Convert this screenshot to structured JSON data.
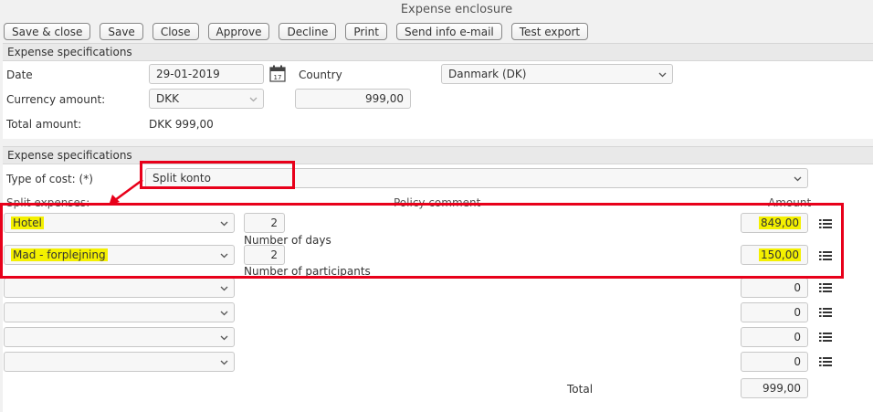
{
  "window_title": "Expense enclosure",
  "toolbar": {
    "buttons": [
      "Save & close",
      "Save",
      "Close",
      "Approve",
      "Decline",
      "Print",
      "Send info e-mail",
      "Test export"
    ]
  },
  "section1": {
    "title": "Expense specifications",
    "date_label": "Date",
    "date_value": "29-01-2019",
    "country_label": "Country",
    "country_value": "Danmark (DK)",
    "currency_label": "Currency amount:",
    "currency_value": "DKK",
    "currency_amount": "999,00",
    "total_label": "Total amount:",
    "total_value": "DKK 999,00"
  },
  "section2": {
    "title": "Expense specifications",
    "type_label": "Type of cost: (*)",
    "type_value": "Split konto",
    "col_split": "Split expenses:",
    "col_policy": "Policy comment",
    "col_amount": "Amount",
    "rows": [
      {
        "expense": "Hotel",
        "qty": "2",
        "qty_label": "Number of days",
        "amount": "849,00"
      },
      {
        "expense": "Mad - forplejning",
        "qty": "2",
        "qty_label": "Number of participants",
        "amount": "150,00"
      },
      {
        "expense": "",
        "amount": "0"
      },
      {
        "expense": "",
        "amount": "0"
      },
      {
        "expense": "",
        "amount": "0"
      },
      {
        "expense": "",
        "amount": "0"
      }
    ],
    "total_label": "Total",
    "total_value": "999,00"
  },
  "colors": {
    "highlight": "#f4f000",
    "annotation_red": "#e8001a"
  },
  "icons": [
    "calendar-icon",
    "chevron-down-icon",
    "list-icon"
  ]
}
